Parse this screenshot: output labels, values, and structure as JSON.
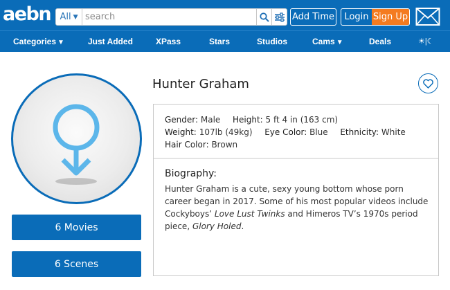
{
  "header": {
    "logo": "aebn",
    "search_scope": "All",
    "search_placeholder": "search",
    "add_time_label": "Add Time",
    "login_label": "Login",
    "signup_label": "Sign Up"
  },
  "nav": {
    "items": [
      {
        "label": "Categories",
        "has_caret": true
      },
      {
        "label": "Just Added"
      },
      {
        "label": "XPass"
      },
      {
        "label": "Stars"
      },
      {
        "label": "Studios"
      },
      {
        "label": "Cams",
        "has_caret": true
      },
      {
        "label": "Deals"
      }
    ],
    "theme_toggle": "☀|☾"
  },
  "star": {
    "name": "Hunter Graham",
    "attributes": {
      "gender": {
        "label": "Gender:",
        "value": "Male"
      },
      "height": {
        "label": "Height:",
        "value": "5 ft 4 in (163 cm)"
      },
      "weight": {
        "label": "Weight:",
        "value": "107lb (49kg)"
      },
      "eye_color": {
        "label": "Eye Color:",
        "value": "Blue"
      },
      "ethnicity": {
        "label": "Ethnicity:",
        "value": "White"
      },
      "hair_color": {
        "label": "Hair Color:",
        "value": "Brown"
      }
    },
    "bio_title": "Biography:",
    "bio_part1": "Hunter Graham is a cute, sexy young bottom whose porn career began in 2017. Some of his most popular videos include Cockyboys’ ",
    "bio_em1": "Love Lust Twinks",
    "bio_part2": " and Himeros TV’s 1970s period piece, ",
    "bio_em2": "Glory Holed",
    "bio_part3": "."
  },
  "sidebar": {
    "movies_label": "6 Movies",
    "scenes_label": "6 Scenes"
  },
  "colors": {
    "brand_blue": "#0a6cb8",
    "signup_orange": "#f47b20",
    "avatar_icon": "#5cb6ea"
  },
  "icons": [
    "search-icon",
    "filter-icon",
    "mail-icon",
    "heart-icon",
    "male-gender-icon",
    "theme-toggle-icon"
  ]
}
